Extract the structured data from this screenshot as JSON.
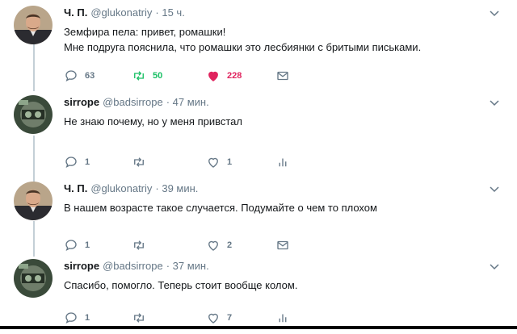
{
  "tweets": [
    {
      "name": "Ч. П.",
      "handle": "@glukonatriy",
      "time": "· 15 ч.",
      "text": "Земфира пела: привет, ромашки!\nМне подруга пояснила, что ромашки это лесбиянки с бритыми письками.",
      "avatar": "avatar-man-photo",
      "actions": [
        {
          "icon": "reply-icon",
          "count": "63"
        },
        {
          "icon": "retweet-icon",
          "count": "50",
          "active": true
        },
        {
          "icon": "like-icon",
          "count": "228",
          "active": true
        },
        {
          "icon": "message-icon",
          "count": ""
        }
      ]
    },
    {
      "name": "sirrope",
      "handle": "@badsirrope",
      "time": "· 47 мин.",
      "text": "Не знаю почему, но у меня привстал",
      "avatar": "avatar-game-photo",
      "actions": [
        {
          "icon": "reply-icon",
          "count": "1"
        },
        {
          "icon": "retweet-icon",
          "count": ""
        },
        {
          "icon": "like-icon",
          "count": "1"
        },
        {
          "icon": "analytics-icon",
          "count": ""
        }
      ]
    },
    {
      "name": "Ч. П.",
      "handle": "@glukonatriy",
      "time": "· 39 мин.",
      "text": "В нашем возрасте такое случается. Подумайте о чем то плохом",
      "avatar": "avatar-man-photo",
      "actions": [
        {
          "icon": "reply-icon",
          "count": "1"
        },
        {
          "icon": "retweet-icon",
          "count": ""
        },
        {
          "icon": "like-icon",
          "count": "2"
        },
        {
          "icon": "message-icon",
          "count": ""
        }
      ]
    },
    {
      "name": "sirrope",
      "handle": "@badsirrope",
      "time": "· 37 мин.",
      "text": "Спасибо, помогло. Теперь стоит вообще колом.",
      "avatar": "avatar-game-photo",
      "actions": [
        {
          "icon": "reply-icon",
          "count": "1"
        },
        {
          "icon": "retweet-icon",
          "count": ""
        },
        {
          "icon": "like-icon",
          "count": "7"
        },
        {
          "icon": "analytics-icon",
          "count": ""
        }
      ]
    }
  ],
  "colors": {
    "text": "#14171a",
    "muted": "#657786",
    "retweet_active": "#17bf63",
    "like_active": "#e0245e",
    "thread_line": "#c4cfd6"
  }
}
